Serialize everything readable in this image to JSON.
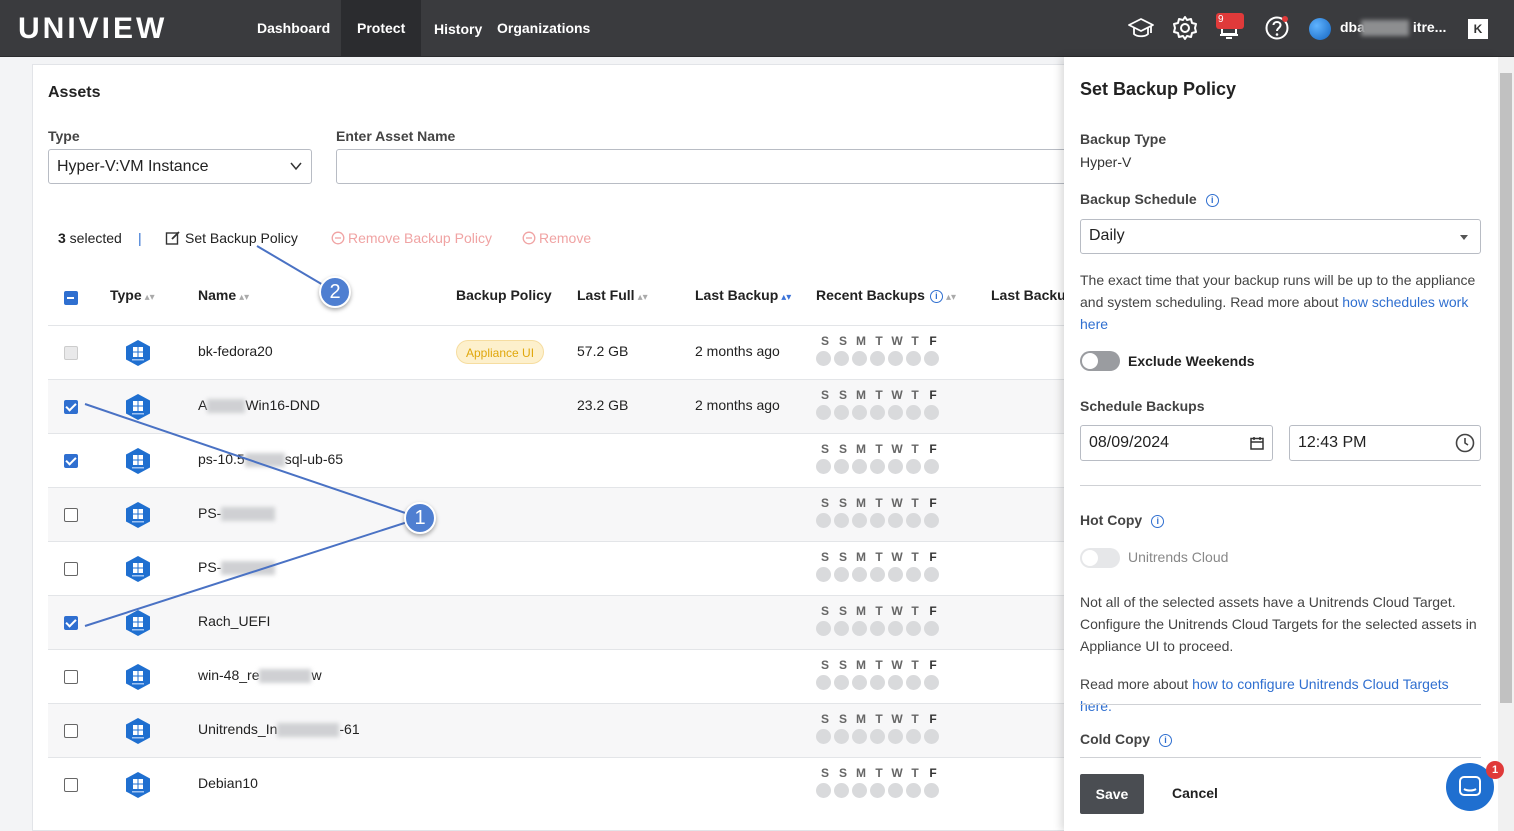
{
  "header": {
    "logo": "UNIVIEW",
    "nav": [
      "Dashboard",
      "Protect",
      "History",
      "Organizations"
    ],
    "active_nav": "Protect",
    "notification_count": "9",
    "user_name_prefix": "dba",
    "user_name_suffix": "itre..."
  },
  "assets": {
    "title": "Assets",
    "type_label": "Type",
    "type_value": "Hyper-V:VM Instance",
    "name_label": "Enter Asset Name",
    "name_value": ""
  },
  "selection": {
    "count": "3",
    "selected_label": " selected",
    "sep": "|",
    "set_policy": "Set Backup Policy",
    "remove_policy": "Remove Backup Policy",
    "remove": "Remove"
  },
  "table": {
    "headers": {
      "type": "Type",
      "name": "Name",
      "policy": "Backup Policy",
      "last_full": "Last Full",
      "last_backup": "Last Backup",
      "recent": "Recent Backups",
      "last_backup2": "Last Backup"
    },
    "day_letters": [
      "S",
      "S",
      "M",
      "T",
      "W",
      "T",
      "F"
    ],
    "rows": [
      {
        "name": "bk-fedora20",
        "policy": "Appliance UI",
        "last_full": "57.2 GB",
        "last_backup": "2 months ago",
        "state": "disabled"
      },
      {
        "name_a": "A",
        "name_b": "Win16-DND",
        "last_full": "23.2 GB",
        "last_backup": "2 months ago",
        "state": "checked"
      },
      {
        "name_a": "ps-10.5",
        "name_b": "sql-ub-65",
        "state": "checked"
      },
      {
        "name_a": "PS-",
        "name_b": "",
        "state": "unchecked"
      },
      {
        "name_a": "PS-",
        "name_b": "",
        "state": "unchecked"
      },
      {
        "name": "Rach_UEFI",
        "state": "checked"
      },
      {
        "name_a": "win-48_re",
        "name_b": "w",
        "state": "unchecked"
      },
      {
        "name_a": "Unitrends_In",
        "name_b": "-61",
        "state": "unchecked"
      },
      {
        "name": "Debian10",
        "state": "unchecked"
      }
    ]
  },
  "panel": {
    "title": "Set Backup Policy",
    "backup_type_label": "Backup Type",
    "backup_type_value": "Hyper-V",
    "schedule_label": "Backup Schedule",
    "schedule_value": "Daily",
    "schedule_note": "The exact time that your backup runs will be up to the appliance and system scheduling. Read more about ",
    "schedule_link": "how schedules work here",
    "exclude_weekends": "Exclude Weekends",
    "schedule_backups_label": "Schedule Backups",
    "date_value": "08/09/2024",
    "time_value": "12:43 PM",
    "hot_copy_label": "Hot Copy",
    "hot_copy_target": "Unitrends Cloud",
    "hot_copy_note": "Not all of the selected assets have a Unitrends Cloud Target. Configure the Unitrends Cloud Targets for the selected assets in Appliance UI to proceed.",
    "read_more": "Read more about ",
    "cloud_link": "how to configure Unitrends Cloud Targets here.",
    "cold_copy_label": "Cold Copy",
    "save": "Save",
    "cancel": "Cancel"
  },
  "chat": {
    "badge": "1"
  },
  "callouts": {
    "one": "1",
    "two": "2"
  },
  "colors": {
    "accent": "#2f6fd0",
    "topbar": "#3a3b3e",
    "callout": "#4f7fd1"
  }
}
